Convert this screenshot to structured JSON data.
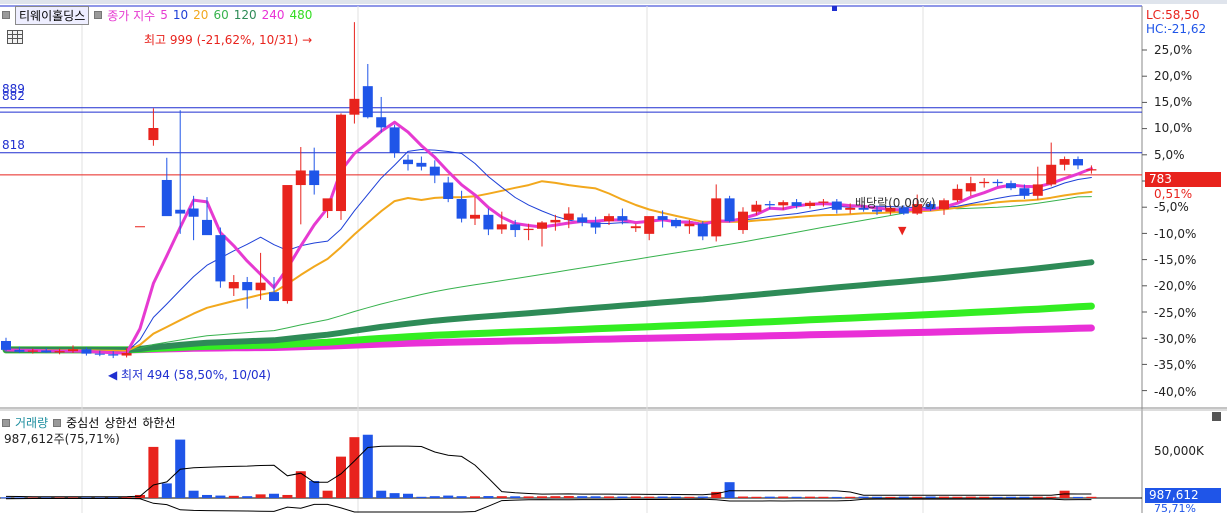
{
  "header": {
    "stock_name": "티웨이홀딩스",
    "indicator": "종가 지수",
    "ma_periods": [
      "5",
      "10",
      "20",
      "60",
      "120",
      "240",
      "480"
    ],
    "ma_colors": [
      "#e63ad1",
      "#1e40d8",
      "#f2a81d",
      "#37b24d",
      "#2e8b57",
      "#33ee22",
      "#e930d7"
    ],
    "lc": "LC:58,50",
    "hc": "HC:-21,62"
  },
  "price_axis": {
    "ticks": [
      "25,0%",
      "20,0%",
      "15,0%",
      "10,0%",
      "5,0%",
      "0,51%",
      "-5,0%",
      "-10,0%",
      "-15,0%",
      "-20,0%",
      "-25,0%",
      "-30,0%",
      "-35,0%",
      "-40,0%"
    ],
    "current_price": "783"
  },
  "levels": [
    {
      "label": "889",
      "value": 889
    },
    {
      "label": "882",
      "value": 882
    },
    {
      "label": "818",
      "value": 818
    }
  ],
  "annotations": {
    "high": "최고 999 (-21,62%, 10/31)",
    "low": "최저 494 (58,50%, 10/04)",
    "dividend": "배당락(0,00%)"
  },
  "volume_panel": {
    "legend_items": [
      "거래량",
      "중심선",
      "상한선",
      "하한선"
    ],
    "current_text": "987,612주(75,71%)",
    "axis_label": "50,000K",
    "current_value": "987,612",
    "current_sub": "75,71%"
  },
  "colors": {
    "up": "#e8231d",
    "down": "#1f55e8",
    "level": "#1f2fd0",
    "reference": "#e8231d"
  },
  "chart_data": {
    "type": "candlestick",
    "price_range": [
      420,
      1040
    ],
    "reference_close": 783,
    "candles": [
      {
        "o": 521,
        "h": 526,
        "l": 505,
        "c": 507
      },
      {
        "o": 507,
        "h": 512,
        "l": 502,
        "c": 504
      },
      {
        "o": 504,
        "h": 509,
        "l": 501,
        "c": 506
      },
      {
        "o": 506,
        "h": 510,
        "l": 502,
        "c": 503
      },
      {
        "o": 503,
        "h": 509,
        "l": 500,
        "c": 505
      },
      {
        "o": 505,
        "h": 514,
        "l": 502,
        "c": 508
      },
      {
        "o": 508,
        "h": 511,
        "l": 498,
        "c": 501
      },
      {
        "o": 501,
        "h": 506,
        "l": 497,
        "c": 500
      },
      {
        "o": 500,
        "h": 505,
        "l": 494,
        "c": 498
      },
      {
        "o": 498,
        "h": 510,
        "l": 495,
        "c": 502
      },
      {
        "o": 702,
        "h": 702,
        "l": 702,
        "c": 702
      },
      {
        "o": 838,
        "h": 888,
        "l": 829,
        "c": 857
      },
      {
        "o": 775,
        "h": 810,
        "l": 725,
        "c": 718
      },
      {
        "o": 728,
        "h": 885,
        "l": 690,
        "c": 722
      },
      {
        "o": 730,
        "h": 750,
        "l": 680,
        "c": 717
      },
      {
        "o": 712,
        "h": 748,
        "l": 690,
        "c": 688
      },
      {
        "o": 688,
        "h": 700,
        "l": 605,
        "c": 615
      },
      {
        "o": 604,
        "h": 625,
        "l": 592,
        "c": 614
      },
      {
        "o": 614,
        "h": 622,
        "l": 572,
        "c": 601
      },
      {
        "o": 601,
        "h": 660,
        "l": 586,
        "c": 613
      },
      {
        "o": 598,
        "h": 622,
        "l": 595,
        "c": 584
      },
      {
        "o": 584,
        "h": 690,
        "l": 580,
        "c": 767
      },
      {
        "o": 767,
        "h": 827,
        "l": 705,
        "c": 790
      },
      {
        "o": 790,
        "h": 826,
        "l": 752,
        "c": 767
      },
      {
        "o": 726,
        "h": 732,
        "l": 715,
        "c": 746
      },
      {
        "o": 726,
        "h": 880,
        "l": 712,
        "c": 878
      },
      {
        "o": 878,
        "h": 1024,
        "l": 864,
        "c": 903
      },
      {
        "o": 923,
        "h": 958,
        "l": 872,
        "c": 874
      },
      {
        "o": 874,
        "h": 906,
        "l": 850,
        "c": 858
      },
      {
        "o": 858,
        "h": 862,
        "l": 810,
        "c": 818
      },
      {
        "o": 807,
        "h": 815,
        "l": 790,
        "c": 800
      },
      {
        "o": 802,
        "h": 812,
        "l": 790,
        "c": 796
      },
      {
        "o": 796,
        "h": 806,
        "l": 770,
        "c": 782
      },
      {
        "o": 771,
        "h": 780,
        "l": 740,
        "c": 745
      },
      {
        "o": 745,
        "h": 758,
        "l": 708,
        "c": 714
      },
      {
        "o": 714,
        "h": 748,
        "l": 704,
        "c": 720
      },
      {
        "o": 720,
        "h": 730,
        "l": 688,
        "c": 697
      },
      {
        "o": 697,
        "h": 725,
        "l": 690,
        "c": 705
      },
      {
        "o": 705,
        "h": 712,
        "l": 685,
        "c": 696
      },
      {
        "o": 696,
        "h": 706,
        "l": 680,
        "c": 698
      },
      {
        "o": 698,
        "h": 710,
        "l": 670,
        "c": 708
      },
      {
        "o": 708,
        "h": 720,
        "l": 695,
        "c": 712
      },
      {
        "o": 712,
        "h": 732,
        "l": 699,
        "c": 722
      },
      {
        "o": 716,
        "h": 722,
        "l": 702,
        "c": 708
      },
      {
        "o": 708,
        "h": 717,
        "l": 690,
        "c": 700
      },
      {
        "o": 710,
        "h": 722,
        "l": 704,
        "c": 718
      },
      {
        "o": 718,
        "h": 730,
        "l": 705,
        "c": 711
      },
      {
        "o": 699,
        "h": 706,
        "l": 693,
        "c": 702
      },
      {
        "o": 690,
        "h": 703,
        "l": 680,
        "c": 718
      },
      {
        "o": 718,
        "h": 727,
        "l": 700,
        "c": 712
      },
      {
        "o": 712,
        "h": 715,
        "l": 699,
        "c": 702
      },
      {
        "o": 702,
        "h": 712,
        "l": 690,
        "c": 706
      },
      {
        "o": 706,
        "h": 710,
        "l": 680,
        "c": 686
      },
      {
        "o": 686,
        "h": 768,
        "l": 678,
        "c": 746
      },
      {
        "o": 746,
        "h": 750,
        "l": 708,
        "c": 710
      },
      {
        "o": 696,
        "h": 732,
        "l": 690,
        "c": 725
      },
      {
        "o": 725,
        "h": 742,
        "l": 720,
        "c": 736
      },
      {
        "o": 737,
        "h": 742,
        "l": 729,
        "c": 735
      },
      {
        "o": 735,
        "h": 743,
        "l": 728,
        "c": 740
      },
      {
        "o": 740,
        "h": 745,
        "l": 730,
        "c": 734
      },
      {
        "o": 734,
        "h": 742,
        "l": 730,
        "c": 739
      },
      {
        "o": 739,
        "h": 745,
        "l": 733,
        "c": 741
      },
      {
        "o": 741,
        "h": 745,
        "l": 722,
        "c": 728
      },
      {
        "o": 728,
        "h": 738,
        "l": 722,
        "c": 731
      },
      {
        "o": 731,
        "h": 735,
        "l": 725,
        "c": 728
      },
      {
        "o": 728,
        "h": 733,
        "l": 720,
        "c": 725
      },
      {
        "o": 725,
        "h": 735,
        "l": 720,
        "c": 731
      },
      {
        "o": 731,
        "h": 735,
        "l": 720,
        "c": 722
      },
      {
        "o": 722,
        "h": 752,
        "l": 720,
        "c": 737
      },
      {
        "o": 737,
        "h": 742,
        "l": 726,
        "c": 729
      },
      {
        "o": 729,
        "h": 746,
        "l": 720,
        "c": 743
      },
      {
        "o": 743,
        "h": 768,
        "l": 740,
        "c": 761
      },
      {
        "o": 757,
        "h": 780,
        "l": 750,
        "c": 770
      },
      {
        "o": 770,
        "h": 778,
        "l": 763,
        "c": 772
      },
      {
        "o": 772,
        "h": 776,
        "l": 765,
        "c": 770
      },
      {
        "o": 770,
        "h": 774,
        "l": 759,
        "c": 762
      },
      {
        "o": 762,
        "h": 768,
        "l": 745,
        "c": 750
      },
      {
        "o": 750,
        "h": 796,
        "l": 744,
        "c": 768
      },
      {
        "o": 768,
        "h": 834,
        "l": 765,
        "c": 799
      },
      {
        "o": 799,
        "h": 812,
        "l": 790,
        "c": 808
      },
      {
        "o": 808,
        "h": 812,
        "l": 792,
        "c": 798
      },
      {
        "o": 790,
        "h": 798,
        "l": 785,
        "c": 792
      }
    ],
    "volume": {
      "range": [
        0,
        60000
      ],
      "bars": [
        600,
        500,
        400,
        450,
        400,
        500,
        450,
        400,
        600,
        700,
        2500,
        42000,
        12000,
        48000,
        6000,
        2500,
        2000,
        1800,
        1500,
        3000,
        3500,
        2500,
        22000,
        14000,
        6000,
        34000,
        50000,
        52000,
        6000,
        4000,
        3500,
        1000,
        1500,
        2000,
        1500,
        1400,
        1600,
        1500,
        1400,
        1300,
        1400,
        1500,
        1600,
        1500,
        1400,
        1300,
        1200,
        1300,
        1100,
        1200,
        1100,
        1000,
        1200,
        5000,
        13000,
        1200,
        1000,
        1100,
        1200,
        1000,
        1100,
        1000,
        900,
        1000,
        1100,
        1000,
        900,
        1100,
        1000,
        1200,
        1100,
        1000,
        1100,
        1000,
        900,
        1000,
        1000,
        1100,
        1000,
        6000,
        900,
        987
      ]
    }
  }
}
